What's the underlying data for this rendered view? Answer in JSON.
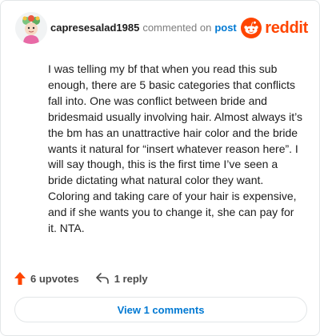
{
  "header": {
    "username": "capresesalad1985",
    "action_text": "commented on",
    "target_text": "post",
    "brand_name": "reddit"
  },
  "comment": {
    "body": "I was telling my bf that when you read this sub enough, there are 5 basic categories that conflicts fall into. One was conflict between bride and bridesmaid usually involving hair. Almost always it’s the bm has an unattractive hair color and the bride wants it natural for “insert whatever reason here”. I will say though, this is the first time I’ve seen a bride dictating what natural color they want. Coloring and taking care of your hair is expensive, and if she wants you to change it, she can pay for it. NTA."
  },
  "footer": {
    "upvotes_label": "6 upvotes",
    "reply_label": "1 reply"
  },
  "view_comments_label": "View 1 comments",
  "icons": {
    "avatar": "avatar",
    "brand": "reddit-logo-icon",
    "upvote": "upvote-arrow-icon",
    "reply": "reply-arrow-icon"
  },
  "colors": {
    "brand": "#ff4500",
    "link": "#0079d3",
    "upvote": "#ff4500",
    "muted": "#7c7c7c",
    "border": "#e3e6e8"
  }
}
